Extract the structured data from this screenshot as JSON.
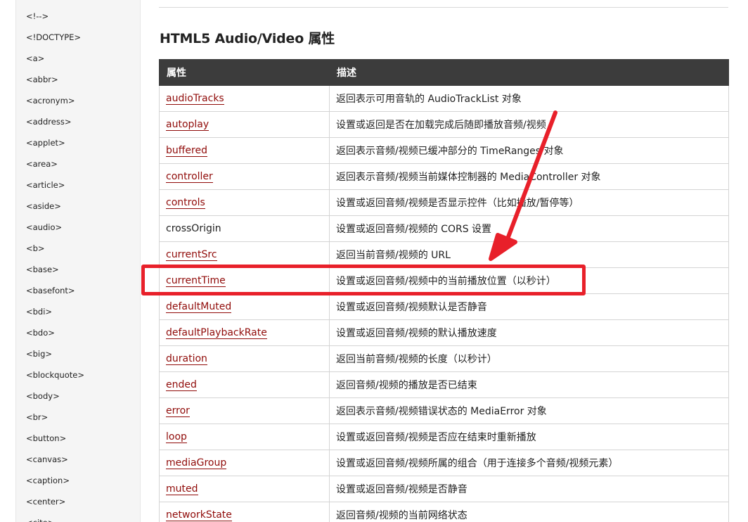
{
  "sidebar": {
    "items": [
      "<!-->",
      "<!DOCTYPE>",
      "<a>",
      "<abbr>",
      "<acronym>",
      "<address>",
      "<applet>",
      "<area>",
      "<article>",
      "<aside>",
      "<audio>",
      "<b>",
      "<base>",
      "<basefont>",
      "<bdi>",
      "<bdo>",
      "<big>",
      "<blockquote>",
      "<body>",
      "<br>",
      "<button>",
      "<canvas>",
      "<caption>",
      "<center>",
      "<cite>"
    ]
  },
  "main": {
    "heading": "HTML5 Audio/Video 属性",
    "table": {
      "headers": [
        "属性",
        "描述"
      ],
      "rows": [
        {
          "name": "audioTracks",
          "desc": "返回表示可用音轨的 AudioTrackList 对象",
          "link": true
        },
        {
          "name": "autoplay",
          "desc": "设置或返回是否在加载完成后随即播放音频/视频",
          "link": true
        },
        {
          "name": "buffered",
          "desc": "返回表示音频/视频已缓冲部分的 TimeRanges 对象",
          "link": true
        },
        {
          "name": "controller",
          "desc": "返回表示音频/视频当前媒体控制器的 MediaController 对象",
          "link": true
        },
        {
          "name": "controls",
          "desc": "设置或返回音频/视频是否显示控件（比如播放/暂停等）",
          "link": true
        },
        {
          "name": "crossOrigin",
          "desc": "设置或返回音频/视频的 CORS 设置",
          "link": false
        },
        {
          "name": "currentSrc",
          "desc": "返回当前音频/视频的 URL",
          "link": true
        },
        {
          "name": "currentTime",
          "desc": "设置或返回音频/视频中的当前播放位置（以秒计）",
          "link": true
        },
        {
          "name": "defaultMuted",
          "desc": "设置或返回音频/视频默认是否静音",
          "link": true
        },
        {
          "name": "defaultPlaybackRate",
          "desc": "设置或返回音频/视频的默认播放速度",
          "link": true
        },
        {
          "name": "duration",
          "desc": "返回当前音频/视频的长度（以秒计）",
          "link": true
        },
        {
          "name": "ended",
          "desc": "返回音频/视频的播放是否已结束",
          "link": true
        },
        {
          "name": "error",
          "desc": "返回表示音频/视频错误状态的 MediaError 对象",
          "link": true
        },
        {
          "name": "loop",
          "desc": "设置或返回音频/视频是否应在结束时重新播放",
          "link": true
        },
        {
          "name": "mediaGroup",
          "desc": "设置或返回音频/视频所属的组合（用于连接多个音频/视频元素）",
          "link": true
        },
        {
          "name": "muted",
          "desc": "设置或返回音频/视频是否静音",
          "link": true
        },
        {
          "name": "networkState",
          "desc": "返回音频/视频的当前网络状态",
          "link": true
        }
      ]
    }
  },
  "annotation": {
    "highlighted_row": "currentTime",
    "color": "#e8202a"
  },
  "colors": {
    "link": "#900b09",
    "table_header_bg": "#3c3c3c",
    "sidebar_bg": "#f5f5f5"
  }
}
